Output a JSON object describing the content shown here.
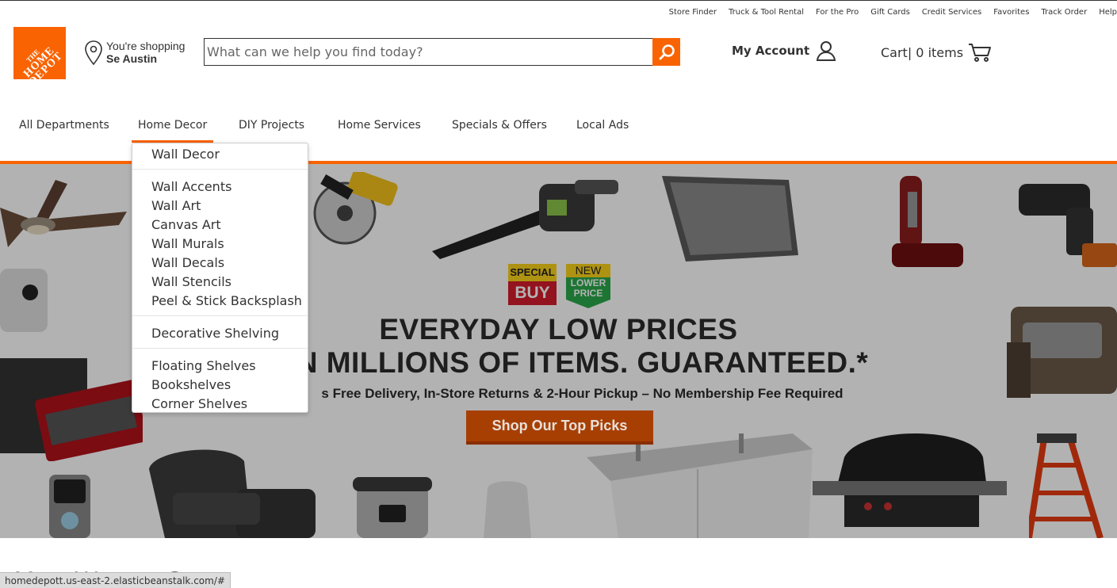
{
  "utility_links": [
    "Store Finder",
    "Truck & Tool Rental",
    "For the Pro",
    "Gift Cards",
    "Credit Services",
    "Favorites",
    "Track Order",
    "Help"
  ],
  "logo": {
    "line1": "THE",
    "line2": "HOME",
    "line3": "DEPOT"
  },
  "store": {
    "line1": "You're shopping",
    "line2": "Se Austin"
  },
  "search": {
    "placeholder": "What can we help you find today?"
  },
  "account": {
    "label": "My Account"
  },
  "cart": {
    "label": "Cart| 0 items"
  },
  "nav": {
    "items": [
      "All Departments",
      "Home Decor",
      "DIY Projects",
      "Home Services",
      "Specials & Offers",
      "Local Ads"
    ],
    "active": "Home Decor"
  },
  "dropdown": {
    "items": [
      "Wall Decor",
      "Wall Accents",
      "Wall Art",
      "Canvas Art",
      "Wall Murals",
      "Wall Decals",
      "Wall Stencils",
      "Peel & Stick Backsplash",
      "Decorative Shelving",
      "Floating Shelves",
      "Bookshelves",
      "Corner Shelves"
    ]
  },
  "hero": {
    "badge_special_top": "SPECIAL",
    "badge_special_bottom": "BUY",
    "badge_new_top": "NEW",
    "badge_new_bottom_1": "LOWER",
    "badge_new_bottom_2": "PRICE",
    "headline1": "EVERYDAY LOW PRICES",
    "headline2": "N MILLIONS OF ITEMS. GUARANTEED.*",
    "subline": "s Free Delivery, In-Store Returns & 2-Hour Pickup – No Membership Fee Required",
    "cta": "Shop Our Top Picks"
  },
  "below_title": "More Ways to Save",
  "status_url": "homedepott.us-east-2.elasticbeanstalk.com/#",
  "colors": {
    "brand": "#f96302",
    "text": "#333333"
  }
}
